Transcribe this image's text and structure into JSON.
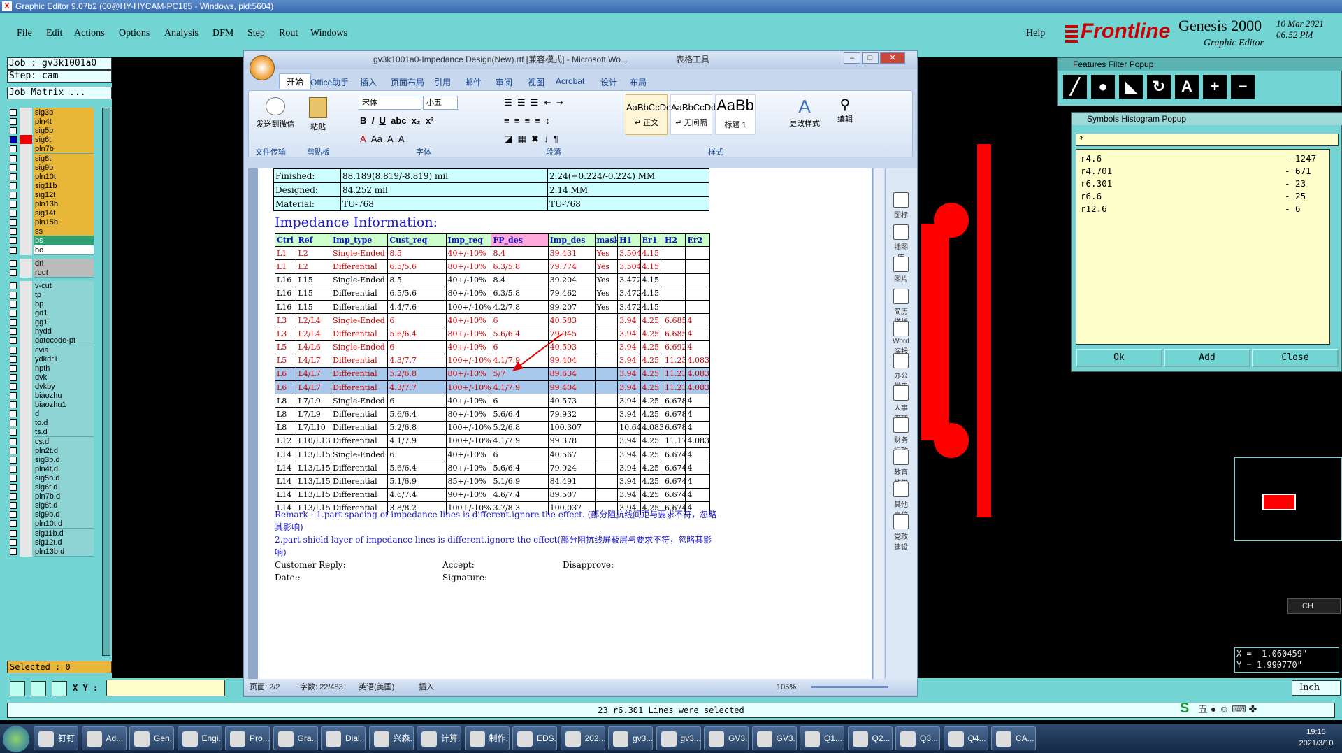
{
  "genesis": {
    "title": "Graphic Editor 9.07b2 (00@HY-HYCAM-PC185 - Windows, pid:5604)",
    "menu": [
      "File",
      "Edit",
      "Actions",
      "Options",
      "Analysis",
      "DFM",
      "Step",
      "Rout",
      "Windows"
    ],
    "help": "Help",
    "brand": "Frontline",
    "product": "Genesis 2000",
    "product_sub": "Graphic Editor",
    "date": "10 Mar 2021",
    "time": "06:52 PM",
    "job": "Job : gv3k1001a0",
    "step": "Step: cam",
    "job_matrix": "Job Matrix ...",
    "selected": "Selected : 0",
    "xy_label": "X Y :",
    "status": "23 r6.301 Lines were selected",
    "units": "Inch",
    "coord_x": "X = -1.060459\"",
    "coord_y": "Y = 1.990770\"",
    "layers": [
      {
        "name": "sig3b",
        "color": "y"
      },
      {
        "name": "pln4t",
        "color": "y"
      },
      {
        "name": "sig5b",
        "color": "y"
      },
      {
        "name": "sig6t",
        "color": "y",
        "active": true
      },
      {
        "name": "pln7b",
        "color": "y"
      },
      {
        "name": "sig8t",
        "color": "y"
      },
      {
        "name": "sig9b",
        "color": "y"
      },
      {
        "name": "pln10t",
        "color": "y"
      },
      {
        "name": "sig11b",
        "color": "y"
      },
      {
        "name": "sig12t",
        "color": "y"
      },
      {
        "name": "pln13b",
        "color": "y"
      },
      {
        "name": "sig14t",
        "color": "y"
      },
      {
        "name": "pln15b",
        "color": "y"
      },
      {
        "name": "ss",
        "color": "y"
      },
      {
        "name": "bs",
        "color": "g"
      },
      {
        "name": "bo",
        "color": "w"
      },
      {
        "name": "drl",
        "color": "gr",
        "gap": true
      },
      {
        "name": "rout",
        "color": "gr"
      },
      {
        "name": "v-cut",
        "color": "c",
        "gap": true
      },
      {
        "name": "tp",
        "color": "c"
      },
      {
        "name": "bp",
        "color": "c"
      },
      {
        "name": "gd1",
        "color": "c"
      },
      {
        "name": "gg1",
        "color": "c"
      },
      {
        "name": "hydd",
        "color": "c"
      },
      {
        "name": "datecode-pt",
        "color": "c"
      },
      {
        "name": "cvia",
        "color": "c"
      },
      {
        "name": "ydkdr1",
        "color": "c"
      },
      {
        "name": "npth",
        "color": "c"
      },
      {
        "name": "dvk",
        "color": "c"
      },
      {
        "name": "dvkby",
        "color": "c"
      },
      {
        "name": "biaozhu",
        "color": "c"
      },
      {
        "name": "biaozhu1",
        "color": "c"
      },
      {
        "name": "d",
        "color": "c"
      },
      {
        "name": "to.d",
        "color": "c"
      },
      {
        "name": "ts.d",
        "color": "c"
      },
      {
        "name": "cs.d",
        "color": "c"
      },
      {
        "name": "pln2t.d",
        "color": "c"
      },
      {
        "name": "sig3b.d",
        "color": "c"
      },
      {
        "name": "pln4t.d",
        "color": "c"
      },
      {
        "name": "sig5b.d",
        "color": "c"
      },
      {
        "name": "sig6t.d",
        "color": "c"
      },
      {
        "name": "pln7b.d",
        "color": "c"
      },
      {
        "name": "sig8t.d",
        "color": "c"
      },
      {
        "name": "sig9b.d",
        "color": "c"
      },
      {
        "name": "pln10t.d",
        "color": "c"
      },
      {
        "name": "sig11b.d",
        "color": "c"
      },
      {
        "name": "sig12t.d",
        "color": "c"
      },
      {
        "name": "pln13b.d",
        "color": "c"
      }
    ]
  },
  "features_filter": {
    "title": "Features Filter Popup"
  },
  "symbols_histogram": {
    "title": "Symbols Histogram Popup",
    "filter": "*",
    "rows": [
      {
        "name": "r4.6",
        "count": "- 1247"
      },
      {
        "name": "r4.701",
        "count": "- 671"
      },
      {
        "name": "r6.301",
        "count": "- 23"
      },
      {
        "name": "r6.6",
        "count": "- 25"
      },
      {
        "name": "r12.6",
        "count": "- 6"
      }
    ],
    "buttons": [
      "Ok",
      "Add",
      "Close"
    ]
  },
  "word": {
    "title": "gv3k1001a0-Impedance Design(New).rtf [兼容模式] - Microsoft Wo...",
    "table_tools": "表格工具",
    "tabs": [
      "开始",
      "Office助手",
      "插入",
      "页面布局",
      "引用",
      "邮件",
      "审阅",
      "视图",
      "Acrobat",
      "设计",
      "布局"
    ],
    "ribbon": {
      "send_wechat": "发送到微信",
      "paste": "粘贴",
      "font_name": "宋体",
      "font_size": "小五",
      "styles": [
        {
          "sample": "AaBbCcDd",
          "label": "↵ 正文"
        },
        {
          "sample": "AaBbCcDd",
          "label": "↵ 无间隔"
        },
        {
          "sample": "AaBb",
          "label": "标题 1"
        }
      ],
      "change_styles": "更改样式",
      "edit": "编辑",
      "groups": [
        "文件传输",
        "剪贴板",
        "字体",
        "段落",
        "样式"
      ]
    },
    "sidebar": [
      "图标",
      "插图库",
      "图片",
      "简历模板",
      "Word海报",
      "办公常用",
      "人事管理",
      "财务行政",
      "教育教学",
      "其他岗位",
      "党政建设"
    ],
    "status": {
      "page": "页面: 2/2",
      "words": "字数: 22/483",
      "lang": "英语(美国)",
      "mode": "插入",
      "zoom": "105%"
    },
    "material": [
      [
        "Finished:",
        "88.189(8.819/-8.819) mil",
        "2.24(+0.224/-0.224) MM"
      ],
      [
        "Designed:",
        "84.252 mil",
        "2.14 MM"
      ],
      [
        "Material:",
        "TU-768",
        "TU-768"
      ]
    ],
    "impedance_title": "Impedance Information:",
    "impedance_header": [
      "Ctrl",
      "Ref",
      "Imp_type",
      "Cust_req",
      "Imp_req",
      "FP_des",
      "Imp_des",
      "mask",
      "H1",
      "Er1",
      "H2",
      "Er2"
    ],
    "impedance_rows": [
      {
        "style": "red",
        "cells": [
          "L1",
          "L2",
          "Single-Ended",
          "8.5",
          "40+/-10%",
          "8.4",
          "39.431",
          "Yes",
          "3.504",
          "4.15",
          "",
          ""
        ]
      },
      {
        "style": "red",
        "cells": [
          "L1",
          "L2",
          "Differential",
          "6.5/5.6",
          "80+/-10%",
          "6.3/5.8",
          "79.774",
          "Yes",
          "3.504",
          "4.15",
          "",
          ""
        ]
      },
      {
        "style": "",
        "cells": [
          "L16",
          "L15",
          "Single-Ended",
          "8.5",
          "40+/-10%",
          "8.4",
          "39.204",
          "Yes",
          "3.472",
          "4.15",
          "",
          ""
        ]
      },
      {
        "style": "",
        "cells": [
          "L16",
          "L15",
          "Differential",
          "6.5/5.6",
          "80+/-10%",
          "6.3/5.8",
          "79.462",
          "Yes",
          "3.472",
          "4.15",
          "",
          ""
        ]
      },
      {
        "style": "",
        "cells": [
          "L16",
          "L15",
          "Differential",
          "4.4/7.6",
          "100+/-10%",
          "4.2/7.8",
          "99.207",
          "Yes",
          "3.472",
          "4.15",
          "",
          ""
        ]
      },
      {
        "style": "red",
        "cells": [
          "L3",
          "L2/L4",
          "Single-Ended",
          "6",
          "40+/-10%",
          "6",
          "40.583",
          "",
          "3.94",
          "4.25",
          "6.685",
          "4"
        ]
      },
      {
        "style": "red",
        "cells": [
          "L3",
          "L2/L4",
          "Differential",
          "5.6/6.4",
          "80+/-10%",
          "5.6/6.4",
          "79.945",
          "",
          "3.94",
          "4.25",
          "6.685",
          "4"
        ]
      },
      {
        "style": "red",
        "cells": [
          "L5",
          "L4/L6",
          "Single-Ended",
          "6",
          "40+/-10%",
          "6",
          "40.593",
          "",
          "3.94",
          "4.25",
          "6.692",
          "4"
        ]
      },
      {
        "style": "red",
        "cells": [
          "L5",
          "L4/L7",
          "Differential",
          "4.3/7.7",
          "100+/-10%",
          "4.1/7.9",
          "99.404",
          "",
          "3.94",
          "4.25",
          "11.232",
          "4.083"
        ]
      },
      {
        "style": "red sel",
        "cells": [
          "L6",
          "L4/L7",
          "Differential",
          "5.2/6.8",
          "80+/-10%",
          "5/7",
          "89.634",
          "",
          "3.94",
          "4.25",
          "11.232",
          "4.083"
        ]
      },
      {
        "style": "red sel",
        "cells": [
          "L6",
          "L4/L7",
          "Differential",
          "4.3/7.7",
          "100+/-10%",
          "4.1/7.9",
          "99.404",
          "",
          "3.94",
          "4.25",
          "11.232",
          "4.083"
        ]
      },
      {
        "style": "",
        "cells": [
          "L8",
          "L7/L9",
          "Single-Ended",
          "6",
          "40+/-10%",
          "6",
          "40.573",
          "",
          "3.94",
          "4.25",
          "6.678",
          "4"
        ]
      },
      {
        "style": "",
        "cells": [
          "L8",
          "L7/L9",
          "Differential",
          "5.6/6.4",
          "80+/-10%",
          "5.6/6.4",
          "79.932",
          "",
          "3.94",
          "4.25",
          "6.678",
          "4"
        ]
      },
      {
        "style": "",
        "cells": [
          "L8",
          "L7/L10",
          "Differential",
          "5.2/6.8",
          "100+/-10%",
          "5.2/6.8",
          "100.307",
          "",
          "10.642",
          "4.083",
          "6.678",
          "4"
        ]
      },
      {
        "style": "",
        "cells": [
          "L12",
          "L10/L13",
          "Differential",
          "4.1/7.9",
          "100+/-10%",
          "4.1/7.9",
          "99.378",
          "",
          "3.94",
          "4.25",
          "11.177",
          "4.083"
        ]
      },
      {
        "style": "",
        "cells": [
          "L14",
          "L13/L15",
          "Single-Ended",
          "6",
          "40+/-10%",
          "6",
          "40.567",
          "",
          "3.94",
          "4.25",
          "6.674",
          "4"
        ]
      },
      {
        "style": "",
        "cells": [
          "L14",
          "L13/L15",
          "Differential",
          "5.6/6.4",
          "80+/-10%",
          "5.6/6.4",
          "79.924",
          "",
          "3.94",
          "4.25",
          "6.674",
          "4"
        ]
      },
      {
        "style": "",
        "cells": [
          "L14",
          "L13/L15",
          "Differential",
          "5.1/6.9",
          "85+/-10%",
          "5.1/6.9",
          "84.491",
          "",
          "3.94",
          "4.25",
          "6.674",
          "4"
        ]
      },
      {
        "style": "",
        "cells": [
          "L14",
          "L13/L15",
          "Differential",
          "4.6/7.4",
          "90+/-10%",
          "4.6/7.4",
          "89.507",
          "",
          "3.94",
          "4.25",
          "6.674",
          "4"
        ]
      },
      {
        "style": "",
        "cells": [
          "L14",
          "L13/L15",
          "Differential",
          "3.8/8.2",
          "100+/-10%",
          "3.7/8.3",
          "100.037",
          "",
          "3.94",
          "4.25",
          "6.674",
          "4"
        ]
      }
    ],
    "remark1": "Remark : 1.part spacing of impedance lines is different.ignore the effect. (部分阻抗线间距与要求不符，忽略其影响)",
    "remark2": "2.part shield layer of impedance lines is different.ignore the effect(部分阻抗线屏蔽层与要求不符，忽略其影响)",
    "customer_reply": "Customer Reply:",
    "accept": "Accept:",
    "disapprove": "Disapprove:",
    "date": "Date::",
    "signature": "Signature:"
  },
  "taskbar": {
    "items": [
      "钉钉",
      "Ad...",
      "Gen...",
      "Engi...",
      "Pro...",
      "Gra...",
      "Dial...",
      "兴森...",
      "计算...",
      "制作...",
      "EDS...",
      "202...",
      "gv3...",
      "gv3...",
      "GV3...",
      "GV3...",
      "Q1...",
      "Q2...",
      "Q3...",
      "Q4...",
      "CA..."
    ],
    "time": "19:15",
    "date": "2021/3/10"
  },
  "ime": {
    "label": "CH"
  }
}
